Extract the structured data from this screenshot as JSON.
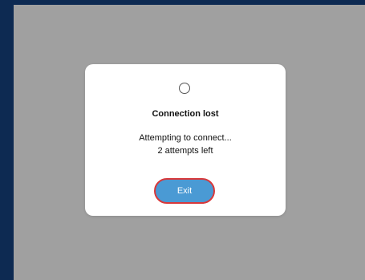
{
  "dialog": {
    "title": "Connection lost",
    "message_line1": "Attempting to connect...",
    "message_line2": "2 attempts left",
    "exit_label": "Exit"
  },
  "colors": {
    "app_background": "#0d2a52",
    "overlay": "#a0a0a0",
    "dialog_background": "#ffffff",
    "button_fill": "#4a9ad4",
    "button_focus_ring": "#d9383a"
  },
  "icons": {
    "spinner": "loading-spinner-icon"
  }
}
